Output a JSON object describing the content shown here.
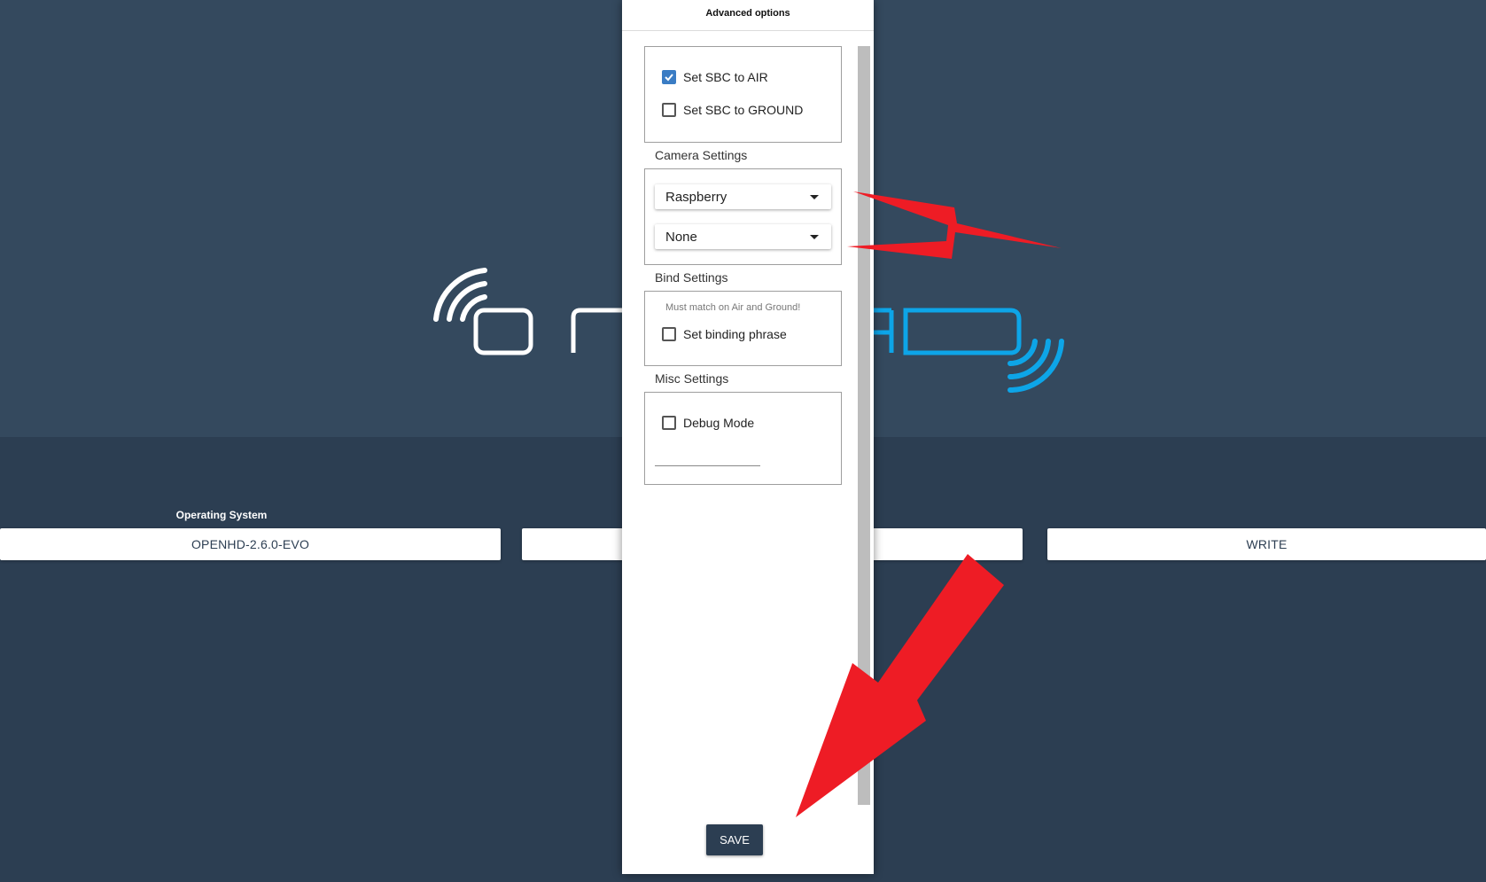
{
  "main": {
    "os_label": "Operating System",
    "os_value": "OPENHD-2.6.0-EVO",
    "write_label": "WRITE"
  },
  "modal": {
    "title": "Advanced options",
    "sbc_air_label": "Set SBC to AIR",
    "sbc_air_checked": true,
    "sbc_ground_label": "Set SBC to GROUND",
    "sbc_ground_checked": false,
    "camera_section": "Camera Settings",
    "camera_primary": "Raspberry",
    "camera_secondary": "None",
    "bind_section": "Bind Settings",
    "bind_hint": "Must match on Air and Ground!",
    "bind_phrase_label": "Set binding phrase",
    "misc_section": "Misc Settings",
    "debug_label": "Debug Mode",
    "save_label": "SAVE"
  },
  "colors": {
    "hero_bg": "#34495e",
    "page_bg": "#2c3e52",
    "logo_blue": "#0da5e8",
    "checkbox_accent": "#3a7cc4",
    "annotation_red": "#ee1c25"
  },
  "icons": [
    "wifi-signal-icon",
    "checkmark-icon",
    "dropdown-caret-icon",
    "red-arrow-annotation"
  ]
}
